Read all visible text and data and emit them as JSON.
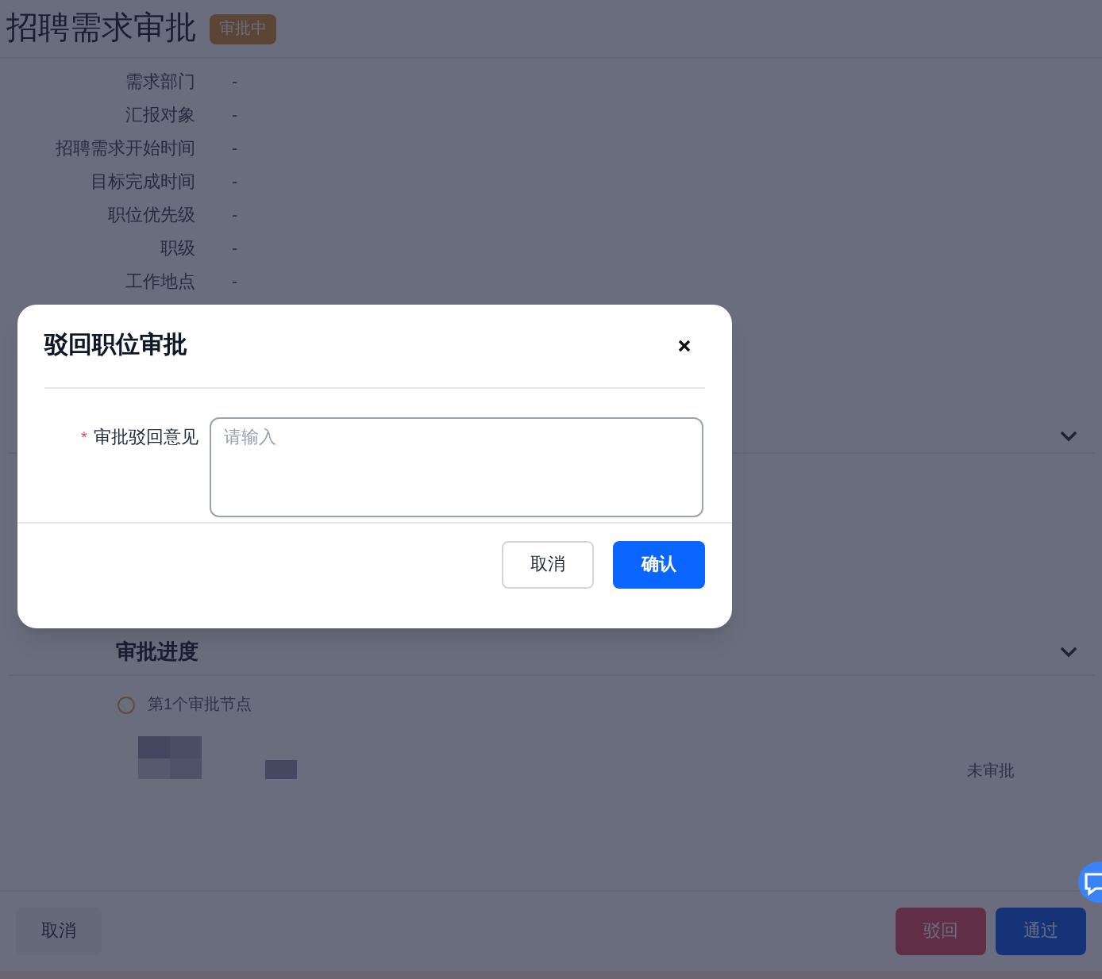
{
  "page": {
    "title": "招聘需求审批",
    "status_badge": "审批中"
  },
  "fields": [
    {
      "label": "需求部门",
      "value": "-"
    },
    {
      "label": "汇报对象",
      "value": "-"
    },
    {
      "label": "招聘需求开始时间",
      "value": "-"
    },
    {
      "label": "目标完成时间",
      "value": "-"
    },
    {
      "label": "职位优先级",
      "value": "-"
    },
    {
      "label": "职级",
      "value": "-"
    },
    {
      "label": "工作地点",
      "value": "-"
    }
  ],
  "progress": {
    "title": "审批进度",
    "node_label": "第1个审批节点",
    "node_status": "未审批"
  },
  "footer": {
    "cancel": "取消",
    "reject": "驳回",
    "approve": "通过"
  },
  "dialog": {
    "title": "驳回职位审批",
    "required_mark": "*",
    "field_label": "审批驳回意见",
    "placeholder": "请输入",
    "cancel": "取消",
    "confirm": "确认"
  }
}
